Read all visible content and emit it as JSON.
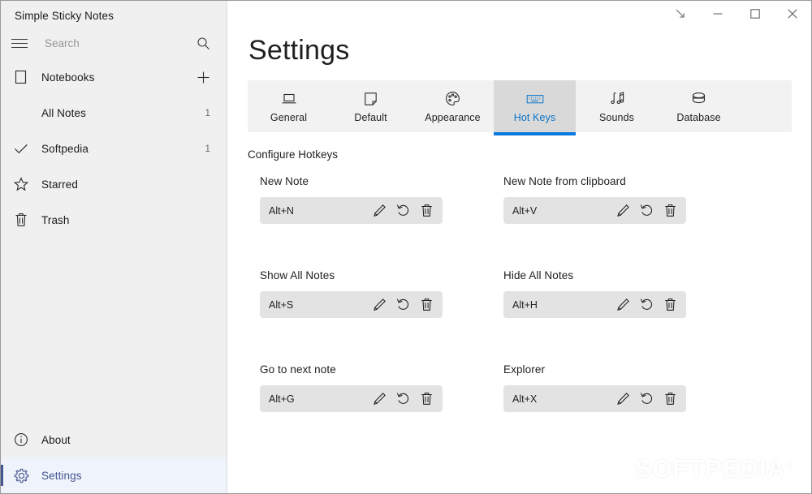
{
  "app": {
    "title": "Simple Sticky Notes"
  },
  "titlebar": {
    "controls": [
      {
        "name": "collapse-button",
        "glyph": "arrow-down-right-icon"
      },
      {
        "name": "minimize-button",
        "glyph": "minimize-icon"
      },
      {
        "name": "maximize-button",
        "glyph": "maximize-icon"
      },
      {
        "name": "close-button",
        "glyph": "close-icon"
      }
    ]
  },
  "sidebar": {
    "search": {
      "placeholder": "Search",
      "value": ""
    },
    "items": [
      {
        "label": "Notebooks",
        "icon": "notebook-icon",
        "count": "",
        "trailing": "plus-icon"
      },
      {
        "label": "All Notes",
        "icon": "",
        "count": "1",
        "trailing": ""
      },
      {
        "label": "Softpedia",
        "icon": "check-icon",
        "count": "1",
        "trailing": ""
      },
      {
        "label": "Starred",
        "icon": "star-icon",
        "count": "",
        "trailing": ""
      },
      {
        "label": "Trash",
        "icon": "trash-icon",
        "count": "",
        "trailing": ""
      }
    ],
    "bottom_items": [
      {
        "label": "About",
        "icon": "info-icon",
        "selected": false
      },
      {
        "label": "Settings",
        "icon": "gear-icon",
        "selected": true
      }
    ]
  },
  "main": {
    "page_title": "Settings",
    "tabs": [
      {
        "label": "General",
        "icon": "laptop-icon",
        "active": false
      },
      {
        "label": "Default",
        "icon": "note-icon",
        "active": false
      },
      {
        "label": "Appearance",
        "icon": "palette-icon",
        "active": false
      },
      {
        "label": "Hot Keys",
        "icon": "keyboard-icon",
        "active": true
      },
      {
        "label": "Sounds",
        "icon": "music-notes-icon",
        "active": false
      },
      {
        "label": "Database",
        "icon": "database-icon",
        "active": false
      }
    ],
    "section_title": "Configure Hotkeys",
    "hotkeys": [
      {
        "label": "New Note",
        "value": "Alt+N"
      },
      {
        "label": "New Note from clipboard",
        "value": "Alt+V"
      },
      {
        "label": "Show All Notes",
        "value": "Alt+S"
      },
      {
        "label": "Hide All Notes",
        "value": "Alt+H"
      },
      {
        "label": "Go to next note",
        "value": "Alt+G"
      },
      {
        "label": "Explorer",
        "value": "Alt+X"
      }
    ],
    "hotkey_actions": [
      {
        "name": "edit-hotkey-button",
        "icon": "pencil-icon"
      },
      {
        "name": "reset-hotkey-button",
        "icon": "reset-icon"
      },
      {
        "name": "delete-hotkey-button",
        "icon": "trash-icon"
      }
    ],
    "watermark": "SOFTPEDIA"
  },
  "colors": {
    "accent_blue": "#0a7ae0",
    "tab_active_bg": "#d9d9d9",
    "sidebar_bg": "#f0f0f0",
    "selected_nav_blue": "#44558f",
    "selected_nav_bg": "#eff4fc",
    "field_bg": "#e3e3e3"
  }
}
